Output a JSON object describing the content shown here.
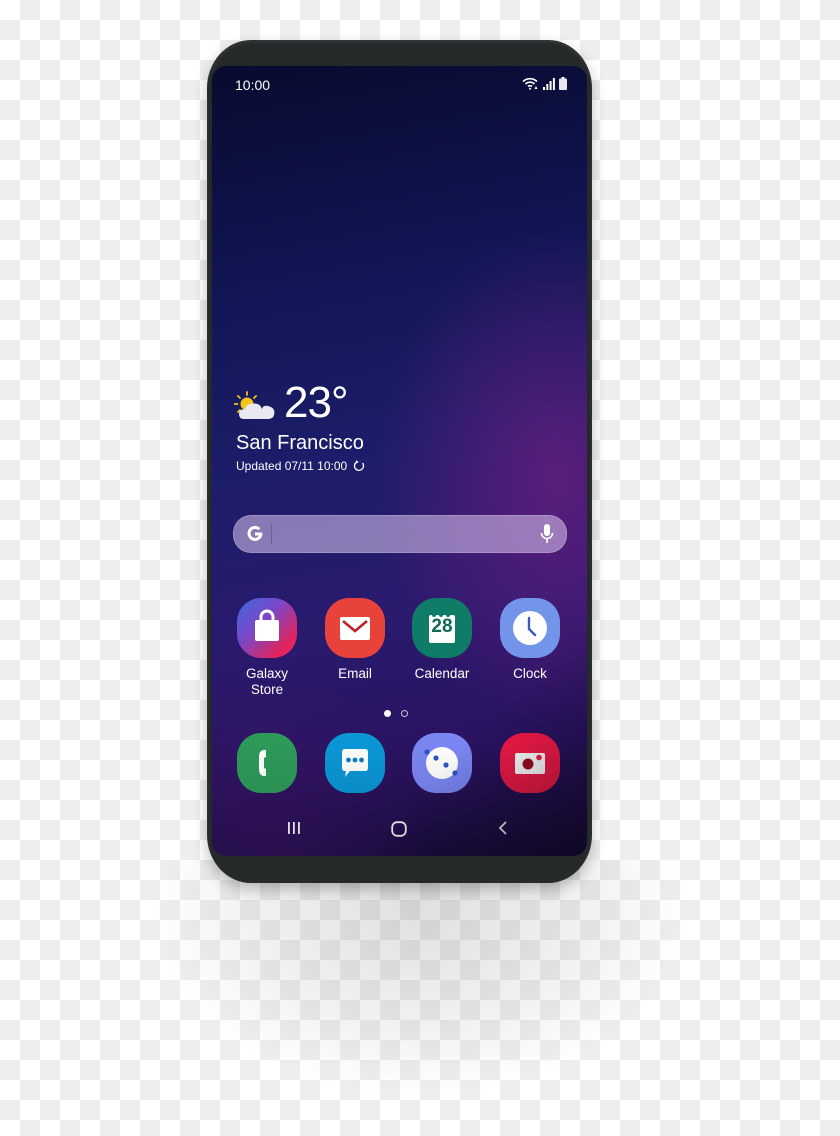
{
  "status_bar": {
    "time": "10:00",
    "icons": [
      "wifi-icon",
      "signal-icon",
      "battery-icon"
    ]
  },
  "weather": {
    "icon": "partly-cloudy-icon",
    "temperature": "23°",
    "city": "San Francisco",
    "updated": "Updated 07/11 10:00",
    "refresh_icon": "refresh-icon"
  },
  "search_bar": {
    "logo": "google-g-icon",
    "value": "",
    "mic_icon": "microphone-icon"
  },
  "apps": [
    {
      "label": "Galaxy Store",
      "label_line1": "Galaxy",
      "label_line2": "Store",
      "icon": "galaxy-store-icon",
      "color": "#e0245e"
    },
    {
      "label": "Email",
      "icon": "email-icon",
      "color": "#e8433a"
    },
    {
      "label": "Calendar",
      "icon": "calendar-icon",
      "day": "28",
      "color": "#0e7c66"
    },
    {
      "label": "Clock",
      "icon": "clock-icon",
      "color": "#7295ea"
    }
  ],
  "page_indicator": {
    "total": 2,
    "current": 1
  },
  "dock": [
    {
      "name": "Phone",
      "icon": "phone-icon",
      "color": "#2e9a5a"
    },
    {
      "name": "Messages",
      "icon": "messages-icon",
      "color": "#0a97d6"
    },
    {
      "name": "Bixby",
      "icon": "bixby-icon",
      "color": "#7b86f3"
    },
    {
      "name": "Camera",
      "icon": "camera-icon",
      "color": "#ef1a48"
    }
  ],
  "nav_bar": {
    "recents": "recents-icon",
    "home": "home-icon",
    "back": "back-icon"
  }
}
